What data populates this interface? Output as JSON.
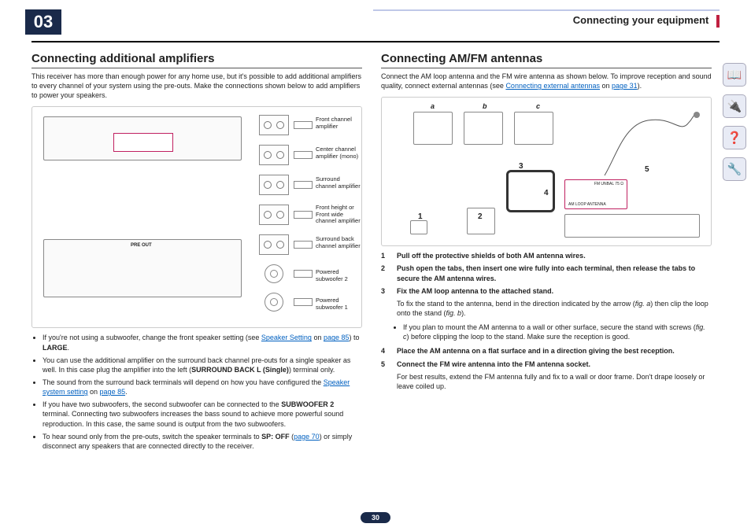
{
  "header": {
    "chapter": "03",
    "title": "Connecting your equipment"
  },
  "left": {
    "heading": "Connecting additional amplifiers",
    "intro": "This receiver has more than enough power for any home use, but it's possible to add additional amplifiers to every channel of your system using the pre-outs. Make the connections shown below to add amplifiers to power your speakers.",
    "amp_labels": [
      "Front channel amplifier",
      "Center channel amplifier (mono)",
      "Surround channel amplifier",
      "Front height or Front wide channel amplifier",
      "Surround back channel amplifier",
      "Powered subwoofer 2",
      "Powered subwoofer 1"
    ],
    "panel_label": "PRE OUT",
    "bullets": [
      {
        "pre": "If you're not using a subwoofer, change the front speaker setting (see ",
        "link": "Speaker Setting",
        "mid": " on ",
        "link2": "page 85",
        "post": ") to ",
        "bold": "LARGE",
        "end": "."
      },
      {
        "pre": "You can use the additional amplifier on the surround back channel pre-outs for a single speaker as well. In this case plug the amplifier into the left (",
        "bold": "SURROUND BACK L (Single)",
        "post": ") terminal only."
      },
      {
        "pre": "The sound from the surround back terminals will depend on how you have configured the ",
        "link": "Speaker system setting",
        "mid": " on ",
        "link2": "page 85",
        "post": "."
      },
      {
        "pre": "If you have two subwoofers, the second subwoofer can be connected to the ",
        "bold": "SUBWOOFER 2",
        "post": " terminal. Connecting two subwoofers increases the bass sound to achieve more powerful sound reproduction. In this case, the same sound is output from the two subwoofers."
      },
      {
        "pre": "To hear sound only from the pre-outs, switch the speaker terminals to ",
        "bold": "SP: OFF",
        "mid": " (",
        "link2": "page 70",
        "post": ") or simply disconnect any speakers that are connected directly to the receiver."
      }
    ]
  },
  "right": {
    "heading": "Connecting AM/FM antennas",
    "intro_pre": "Connect the AM loop antenna and the FM wire antenna as shown below. To improve reception and sound quality, connect external antennas (see ",
    "intro_link": "Connecting external antennas",
    "intro_mid": " on ",
    "intro_link2": "page 31",
    "intro_post": ").",
    "fig_labels": {
      "a": "a",
      "b": "b",
      "c": "c"
    },
    "callouts": {
      "n1": "1",
      "n2": "2",
      "n3": "3",
      "n4": "4",
      "n5": "5"
    },
    "term_labels": {
      "am": "AM LOOP ANTENNA",
      "fm": "FM UNBAL 75 Ω"
    },
    "steps": [
      {
        "n": "1",
        "t": "Pull off the protective shields of both AM antenna wires."
      },
      {
        "n": "2",
        "t": "Push open the tabs, then insert one wire fully into each terminal, then release the tabs to secure the AM antenna wires."
      },
      {
        "n": "3",
        "t": "Fix the AM loop antenna to the attached stand."
      }
    ],
    "step3_sub_pre": "To fix the stand to the antenna, bend in the direction indicated by the arrow (",
    "step3_sub_figa": "fig. a",
    "step3_sub_mid": ") then clip the loop onto the stand (",
    "step3_sub_figb": "fig. b",
    "step3_sub_post": ").",
    "step3_bullet_pre": "If you plan to mount the AM antenna to a wall or other surface, secure the stand with screws (",
    "step3_bullet_figc": "fig. c",
    "step3_bullet_post": ") before clipping the loop to the stand. Make sure the reception is good.",
    "steps2": [
      {
        "n": "4",
        "t": "Place the AM antenna on a flat surface and in a direction giving the best reception."
      },
      {
        "n": "5",
        "t": "Connect the FM wire antenna into the FM antenna socket."
      }
    ],
    "step5_sub": "For best results, extend the FM antenna fully and fix to a wall or door frame. Don't drape loosely or leave coiled up."
  },
  "side_icons": [
    "book-icon",
    "equipment-icon",
    "help-icon",
    "network-icon"
  ],
  "side_glyphs": [
    "📖",
    "🔌",
    "❓",
    "🔧"
  ],
  "footer": {
    "page": "30"
  }
}
